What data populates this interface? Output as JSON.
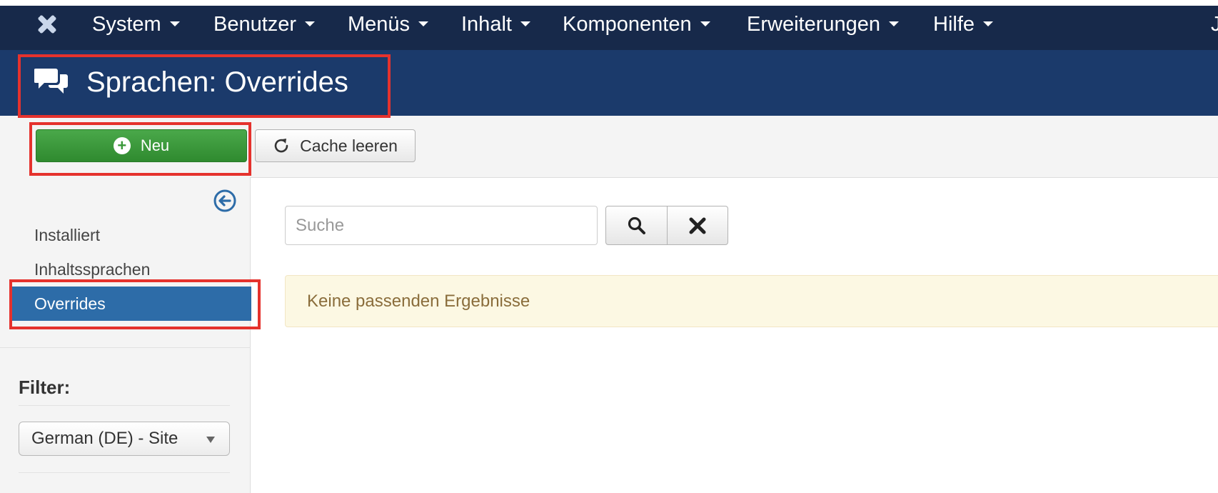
{
  "nav": {
    "items": [
      "System",
      "Benutzer",
      "Menüs",
      "Inhalt",
      "Komponenten",
      "Erweiterungen",
      "Hilfe"
    ],
    "edge_text": "J"
  },
  "header": {
    "title": "Sprachen: Overrides"
  },
  "toolbar": {
    "new_label": "Neu",
    "clear_cache_label": "Cache leeren"
  },
  "sidebar": {
    "items": [
      {
        "label": "Installiert",
        "active": false
      },
      {
        "label": "Inhaltssprachen",
        "active": false
      },
      {
        "label": "Overrides",
        "active": true
      }
    ],
    "filter_label": "Filter:",
    "filter_value": "German (DE) - Site"
  },
  "search": {
    "placeholder": "Suche"
  },
  "message": "Keine passenden Ergebnisse",
  "colors": {
    "topbar": "#17294a",
    "titlebar": "#1b3a6b",
    "new_button": "#3a993a",
    "active_item": "#2d6ca8",
    "highlight": "#e5322d"
  },
  "icons": {
    "logo": "joomla-logo-icon",
    "title": "speech-bubbles-icon",
    "new": "plus-circle-icon",
    "cache": "refresh-icon",
    "collapse": "arrow-left-circle-icon",
    "search": "search-icon",
    "clear": "close-icon"
  }
}
